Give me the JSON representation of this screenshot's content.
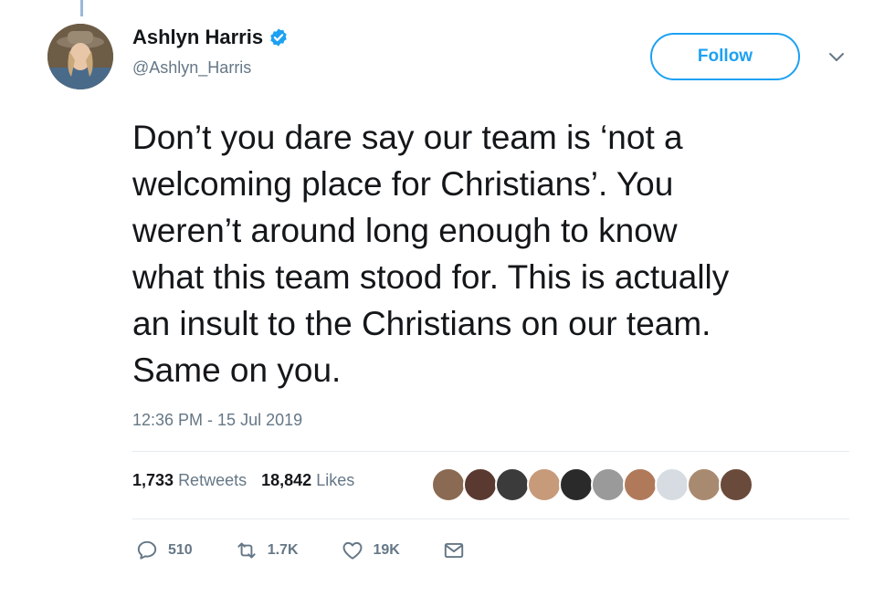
{
  "user": {
    "display_name": "Ashlyn Harris",
    "handle": "@Ashlyn_Harris",
    "verified": true
  },
  "follow_button": {
    "label": "Follow"
  },
  "tweet": {
    "text": "Don’t you dare say our team is ‘not a\nwelcoming place for Christians’. You\nweren’t around long enough to know\nwhat this team stood for. This is actually\nan insult to the Christians on our team.\nSame on you.",
    "timestamp": "12:36 PM - 15 Jul 2019"
  },
  "stats": {
    "retweets_count": "1,733",
    "retweets_label": "Retweets",
    "likes_count": "18,842",
    "likes_label": "Likes"
  },
  "actions": {
    "replies": "510",
    "retweets": "1.7K",
    "likes": "19K"
  },
  "colors": {
    "accent": "#1da1f2",
    "secondary_text": "#657786",
    "divider": "#e6ecf0"
  }
}
